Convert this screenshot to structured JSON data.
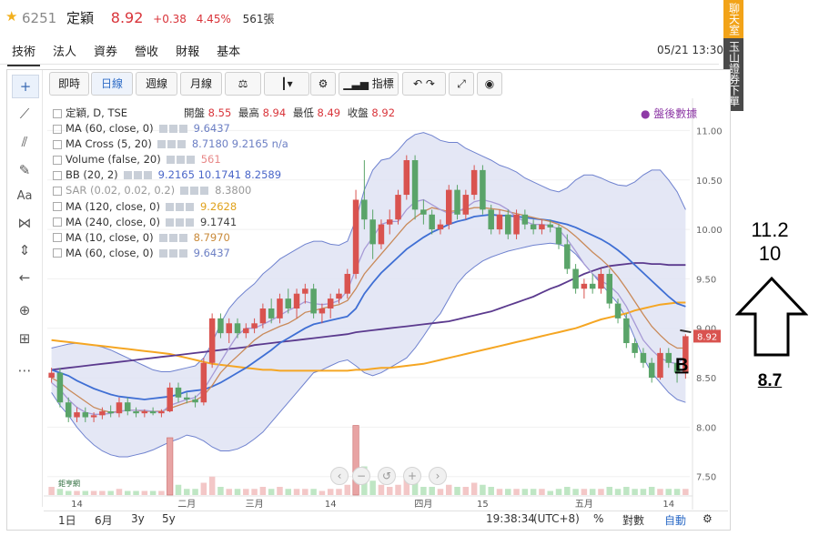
{
  "header": {
    "code": "6251",
    "name": "定穎",
    "price": "8.92",
    "change": "+0.38",
    "change_pct": "4.45%",
    "volume": "561張"
  },
  "tabs": [
    "技術",
    "法人",
    "資券",
    "營收",
    "財報",
    "基本"
  ],
  "timestamp": "05/21 13:30",
  "side_tabs": [
    {
      "label": "聊天室",
      "color": "#f2a318"
    },
    {
      "label": "玉山證券下單",
      "color": "#4a4a4a"
    }
  ],
  "toolbar": {
    "realtime": "即時",
    "daily": "日線",
    "weekly": "週線",
    "monthly": "月線",
    "indicators": "指標"
  },
  "ohlc": {
    "open_label": "開盤",
    "open": "8.55",
    "high_label": "最高",
    "high": "8.94",
    "low_label": "最低",
    "low": "8.49",
    "close_label": "收盤",
    "close": "8.92"
  },
  "legend": [
    {
      "name": "定穎, D, TSE",
      "value": "",
      "color": "#333333"
    },
    {
      "name": "MA (60, close, 0)",
      "value": "9.6437",
      "color": "#6c7fc4"
    },
    {
      "name": "MA Cross (5, 20)",
      "value": "8.7180  9.2165 n/a",
      "color": "#6c7fc4"
    },
    {
      "name": "Volume (false, 20)",
      "value": "561",
      "color": "#e88888"
    },
    {
      "name": "BB (20, 2)",
      "value": "9.2165  10.1741  8.2589",
      "color": "#4a66c8"
    },
    {
      "name": "SAR (0.02, 0.02, 0.2)",
      "value": "8.3800",
      "color": "#999999"
    },
    {
      "name": "MA (120, close, 0)",
      "value": "9.2628",
      "color": "#e0a21c"
    },
    {
      "name": "MA (240, close, 0)",
      "value": "9.1741",
      "color": "#444444"
    },
    {
      "name": "MA (10, close, 0)",
      "value": "8.7970",
      "color": "#c98a3a"
    },
    {
      "name": "MA (60, close, 0)",
      "value": "9.6437",
      "color": "#6c7fc4"
    }
  ],
  "after_hours": "盤後數據",
  "bottom_bar": {
    "ranges": [
      "1日",
      "6月",
      "3y",
      "5y"
    ],
    "clock": "19:38:34",
    "tz": "(UTC+8)",
    "pct": "%",
    "log": "對數",
    "auto": "自動"
  },
  "logo_text": "鉅亨網",
  "annotations": {
    "target_high": "11.2",
    "target_mid": "10",
    "support": "8.7",
    "marker": "B"
  },
  "colors": {
    "up": "#d9534f",
    "down": "#5aa469",
    "bb_fill": "#dfe3f3",
    "ma_blue": "#3f6fd4",
    "ma_purple": "#5b3a8e",
    "ma_orange": "#f5a623",
    "ma_brown": "#c98a5a"
  },
  "chart_data": {
    "type": "candlestick",
    "x_tick_labels": [
      "14",
      "二月",
      "三月",
      "14",
      "四月",
      "15",
      "五月",
      "14"
    ],
    "y_tick_labels": [
      "7.50",
      "8.00",
      "8.50",
      "9.00",
      "9.50",
      "10.00",
      "10.50",
      "11.00"
    ],
    "ylim": [
      7.35,
      11.05
    ],
    "last_price_label": "8.92",
    "candles": [
      [
        8.5,
        8.6,
        8.45,
        8.55
      ],
      [
        8.55,
        8.6,
        8.2,
        8.25
      ],
      [
        8.25,
        8.3,
        8.05,
        8.1
      ],
      [
        8.1,
        8.2,
        8.05,
        8.15
      ],
      [
        8.15,
        8.2,
        8.05,
        8.1
      ],
      [
        8.1,
        8.15,
        8.05,
        8.12
      ],
      [
        8.12,
        8.2,
        8.08,
        8.16
      ],
      [
        8.16,
        8.22,
        8.1,
        8.14
      ],
      [
        8.14,
        8.3,
        8.1,
        8.25
      ],
      [
        8.25,
        8.3,
        8.12,
        8.16
      ],
      [
        8.16,
        8.2,
        8.1,
        8.14
      ],
      [
        8.14,
        8.18,
        8.1,
        8.16
      ],
      [
        8.16,
        8.2,
        8.12,
        8.14
      ],
      [
        8.14,
        8.18,
        8.1,
        8.16
      ],
      [
        8.16,
        8.45,
        8.15,
        8.4
      ],
      [
        8.4,
        8.45,
        8.25,
        8.3
      ],
      [
        8.3,
        8.35,
        8.24,
        8.28
      ],
      [
        8.28,
        8.32,
        8.2,
        8.25
      ],
      [
        8.25,
        8.7,
        8.22,
        8.65
      ],
      [
        8.65,
        9.15,
        8.6,
        9.1
      ],
      [
        9.1,
        9.15,
        8.9,
        8.95
      ],
      [
        8.95,
        9.1,
        8.85,
        9.05
      ],
      [
        9.05,
        9.1,
        8.9,
        8.95
      ],
      [
        8.95,
        9.05,
        8.9,
        9.0
      ],
      [
        9.0,
        9.1,
        8.95,
        9.05
      ],
      [
        9.05,
        9.25,
        9.0,
        9.2
      ],
      [
        9.2,
        9.3,
        9.05,
        9.1
      ],
      [
        9.1,
        9.35,
        9.05,
        9.3
      ],
      [
        9.3,
        9.4,
        9.15,
        9.2
      ],
      [
        9.2,
        9.4,
        9.1,
        9.35
      ],
      [
        9.35,
        9.45,
        9.25,
        9.4
      ],
      [
        9.4,
        9.45,
        9.1,
        9.15
      ],
      [
        9.15,
        9.25,
        9.05,
        9.2
      ],
      [
        9.2,
        9.35,
        9.1,
        9.3
      ],
      [
        9.3,
        9.4,
        9.25,
        9.35
      ],
      [
        9.35,
        9.6,
        9.3,
        9.55
      ],
      [
        9.55,
        10.4,
        9.5,
        10.3
      ],
      [
        10.3,
        10.7,
        10.0,
        10.1
      ],
      [
        10.1,
        10.2,
        9.7,
        9.85
      ],
      [
        9.85,
        10.1,
        9.8,
        10.05
      ],
      [
        10.05,
        10.2,
        9.95,
        10.1
      ],
      [
        10.1,
        10.4,
        10.05,
        10.35
      ],
      [
        10.35,
        10.75,
        10.3,
        10.7
      ],
      [
        10.7,
        10.75,
        10.1,
        10.2
      ],
      [
        10.2,
        10.3,
        10.05,
        10.15
      ],
      [
        10.15,
        10.2,
        9.95,
        10.0
      ],
      [
        10.0,
        10.1,
        9.95,
        10.05
      ],
      [
        10.05,
        10.45,
        10.0,
        10.4
      ],
      [
        10.4,
        10.45,
        10.1,
        10.15
      ],
      [
        10.15,
        10.4,
        10.1,
        10.35
      ],
      [
        10.35,
        10.65,
        10.3,
        10.6
      ],
      [
        10.6,
        10.65,
        10.15,
        10.2
      ],
      [
        10.2,
        10.25,
        9.95,
        10.0
      ],
      [
        10.0,
        10.2,
        9.95,
        10.15
      ],
      [
        10.15,
        10.2,
        9.9,
        9.95
      ],
      [
        9.95,
        10.2,
        9.9,
        10.15
      ],
      [
        10.15,
        10.2,
        10.0,
        10.05
      ],
      [
        10.05,
        10.1,
        9.95,
        10.0
      ],
      [
        10.0,
        10.1,
        9.95,
        10.05
      ],
      [
        10.05,
        10.1,
        9.97,
        10.02
      ],
      [
        10.02,
        10.05,
        9.8,
        9.85
      ],
      [
        9.85,
        9.95,
        9.55,
        9.6
      ],
      [
        9.6,
        9.65,
        9.35,
        9.4
      ],
      [
        9.4,
        9.5,
        9.3,
        9.45
      ],
      [
        9.45,
        9.55,
        9.35,
        9.4
      ],
      [
        9.4,
        9.6,
        9.35,
        9.55
      ],
      [
        9.55,
        9.6,
        9.2,
        9.25
      ],
      [
        9.25,
        9.3,
        9.05,
        9.1
      ],
      [
        9.1,
        9.15,
        8.8,
        8.85
      ],
      [
        8.85,
        8.9,
        8.7,
        8.75
      ],
      [
        8.75,
        8.8,
        8.6,
        8.65
      ],
      [
        8.65,
        8.7,
        8.45,
        8.5
      ],
      [
        8.5,
        8.8,
        8.48,
        8.75
      ],
      [
        8.75,
        8.8,
        8.6,
        8.65
      ],
      [
        8.65,
        8.7,
        8.45,
        8.55
      ],
      [
        8.55,
        8.94,
        8.49,
        8.92
      ]
    ],
    "volume": [
      4,
      3,
      2,
      2,
      2,
      2,
      2,
      2,
      3,
      2,
      2,
      2,
      2,
      2,
      28,
      5,
      3,
      3,
      6,
      9,
      4,
      3,
      3,
      3,
      3,
      4,
      3,
      4,
      3,
      3,
      3,
      3,
      2,
      3,
      3,
      5,
      34,
      14,
      7,
      5,
      4,
      5,
      8,
      6,
      4,
      4,
      3,
      5,
      4,
      4,
      6,
      5,
      4,
      3,
      3,
      3,
      3,
      3,
      3,
      2,
      3,
      4,
      3,
      3,
      3,
      3,
      4,
      3,
      4,
      3,
      3,
      4,
      3,
      3,
      3,
      3
    ],
    "series": [
      {
        "name": "BB (20, 2)",
        "upper": [
          8.8,
          8.82,
          8.84,
          8.85,
          8.84,
          8.83,
          8.81,
          8.78,
          8.74,
          8.7,
          8.66,
          8.62,
          8.58,
          8.56,
          8.56,
          8.58,
          8.6,
          8.62,
          8.7,
          8.85,
          9.05,
          9.2,
          9.3,
          9.38,
          9.45,
          9.55,
          9.62,
          9.7,
          9.75,
          9.8,
          9.85,
          9.88,
          9.88,
          9.85,
          9.84,
          9.88,
          10.1,
          10.4,
          10.6,
          10.7,
          10.72,
          10.8,
          10.9,
          10.96,
          10.98,
          10.95,
          10.9,
          10.88,
          10.88,
          10.82,
          10.78,
          10.74,
          10.7,
          10.65,
          10.62,
          10.58,
          10.52,
          10.48,
          10.44,
          10.4,
          10.38,
          10.42,
          10.5,
          10.55,
          10.55,
          10.52,
          10.48,
          10.45,
          10.44,
          10.48,
          10.55,
          10.6,
          10.6,
          10.5,
          10.38,
          10.2
        ]
      },
      {
        "name": "BB (20, 2)",
        "lower": [
          8.35,
          8.22,
          8.12,
          8.0,
          7.9,
          7.82,
          7.76,
          7.72,
          7.7,
          7.7,
          7.72,
          7.74,
          7.77,
          7.81,
          7.85,
          7.88,
          7.92,
          7.9,
          7.86,
          7.8,
          7.76,
          7.76,
          7.78,
          7.82,
          7.88,
          7.95,
          8.05,
          8.15,
          8.25,
          8.35,
          8.45,
          8.55,
          8.58,
          8.62,
          8.66,
          8.68,
          8.62,
          8.55,
          8.52,
          8.55,
          8.6,
          8.65,
          8.7,
          8.8,
          8.92,
          9.05,
          9.15,
          9.3,
          9.45,
          9.55,
          9.62,
          9.68,
          9.72,
          9.75,
          9.78,
          9.8,
          9.82,
          9.84,
          9.85,
          9.86,
          9.85,
          9.82,
          9.75,
          9.65,
          9.55,
          9.45,
          9.35,
          9.25,
          9.1,
          8.9,
          8.7,
          8.55,
          8.45,
          8.35,
          8.28,
          8.25
        ]
      },
      {
        "name": "MA (20, close)",
        "values": [
          8.58,
          8.55,
          8.52,
          8.47,
          8.43,
          8.39,
          8.36,
          8.33,
          8.31,
          8.3,
          8.29,
          8.28,
          8.29,
          8.3,
          8.31,
          8.33,
          8.36,
          8.37,
          8.38,
          8.41,
          8.45,
          8.5,
          8.55,
          8.6,
          8.66,
          8.72,
          8.78,
          8.85,
          8.9,
          8.95,
          9.0,
          9.04,
          9.06,
          9.08,
          9.1,
          9.12,
          9.2,
          9.35,
          9.46,
          9.56,
          9.64,
          9.72,
          9.8,
          9.86,
          9.92,
          9.97,
          10.01,
          10.05,
          10.08,
          10.1,
          10.13,
          10.14,
          10.15,
          10.14,
          10.14,
          10.13,
          10.12,
          10.11,
          10.1,
          10.09,
          10.07,
          10.05,
          10.02,
          9.98,
          9.94,
          9.9,
          9.85,
          9.79,
          9.72,
          9.64,
          9.56,
          9.48,
          9.4,
          9.32,
          9.25,
          9.22
        ]
      },
      {
        "name": "MA (10, close, 0)",
        "values": [
          8.5,
          8.45,
          8.38,
          8.32,
          8.26,
          8.2,
          8.17,
          8.15,
          8.16,
          8.17,
          8.17,
          8.16,
          8.16,
          8.16,
          8.19,
          8.22,
          8.25,
          8.27,
          8.32,
          8.42,
          8.55,
          8.64,
          8.72,
          8.8,
          8.88,
          8.94,
          8.98,
          9.02,
          9.05,
          9.1,
          9.16,
          9.18,
          9.2,
          9.22,
          9.24,
          9.28,
          9.4,
          9.55,
          9.65,
          9.75,
          9.85,
          9.95,
          10.05,
          10.12,
          10.18,
          10.22,
          10.2,
          10.18,
          10.19,
          10.2,
          10.22,
          10.22,
          10.21,
          10.2,
          10.18,
          10.16,
          10.14,
          10.12,
          10.1,
          10.08,
          10.05,
          10.0,
          9.93,
          9.85,
          9.77,
          9.7,
          9.62,
          9.52,
          9.4,
          9.27,
          9.14,
          9.02,
          8.93,
          8.85,
          8.8,
          8.8
        ]
      },
      {
        "name": "MA (5, close)",
        "values": [
          8.45,
          8.38,
          8.28,
          8.2,
          8.15,
          8.13,
          8.13,
          8.14,
          8.16,
          8.17,
          8.17,
          8.17,
          8.16,
          8.15,
          8.22,
          8.25,
          8.28,
          8.3,
          8.38,
          8.52,
          8.66,
          8.8,
          8.93,
          9.0,
          9.0,
          9.04,
          9.08,
          9.13,
          9.18,
          9.22,
          9.27,
          9.25,
          9.24,
          9.25,
          9.28,
          9.38,
          9.6,
          9.8,
          9.92,
          10.05,
          10.08,
          10.08,
          10.2,
          10.28,
          10.3,
          10.25,
          10.2,
          10.16,
          10.18,
          10.22,
          10.28,
          10.3,
          10.28,
          10.25,
          10.2,
          10.12,
          10.08,
          10.05,
          10.05,
          10.04,
          10.0,
          9.9,
          9.78,
          9.65,
          9.55,
          9.48,
          9.43,
          9.35,
          9.22,
          9.05,
          8.88,
          8.78,
          8.7,
          8.66,
          8.64,
          8.72
        ]
      },
      {
        "name": "MA (240, close, 0)",
        "values": [
          8.88,
          8.87,
          8.86,
          8.85,
          8.84,
          8.83,
          8.82,
          8.81,
          8.8,
          8.79,
          8.78,
          8.77,
          8.76,
          8.75,
          8.74,
          8.72,
          8.7,
          8.68,
          8.66,
          8.64,
          8.63,
          8.62,
          8.61,
          8.6,
          8.59,
          8.58,
          8.58,
          8.57,
          8.57,
          8.57,
          8.57,
          8.57,
          8.57,
          8.57,
          8.57,
          8.57,
          8.58,
          8.58,
          8.59,
          8.6,
          8.6,
          8.61,
          8.62,
          8.63,
          8.64,
          8.66,
          8.68,
          8.7,
          8.72,
          8.74,
          8.76,
          8.78,
          8.8,
          8.82,
          8.84,
          8.86,
          8.88,
          8.9,
          8.92,
          8.94,
          8.96,
          8.98,
          9.0,
          9.03,
          9.06,
          9.09,
          9.11,
          9.13,
          9.15,
          9.18,
          9.2,
          9.22,
          9.24,
          9.25,
          9.26,
          9.26
        ]
      },
      {
        "name": "MA (120, close, 0)",
        "values": [
          8.58,
          8.59,
          8.6,
          8.61,
          8.62,
          8.63,
          8.64,
          8.65,
          8.66,
          8.67,
          8.68,
          8.69,
          8.7,
          8.71,
          8.72,
          8.73,
          8.74,
          8.75,
          8.76,
          8.77,
          8.78,
          8.79,
          8.8,
          8.81,
          8.83,
          8.84,
          8.85,
          8.86,
          8.87,
          8.88,
          8.89,
          8.9,
          8.91,
          8.92,
          8.93,
          8.94,
          8.96,
          8.97,
          8.98,
          8.99,
          9.0,
          9.01,
          9.02,
          9.03,
          9.04,
          9.05,
          9.06,
          9.07,
          9.09,
          9.11,
          9.13,
          9.15,
          9.17,
          9.2,
          9.23,
          9.26,
          9.29,
          9.32,
          9.36,
          9.4,
          9.43,
          9.47,
          9.51,
          9.55,
          9.58,
          9.61,
          9.63,
          9.64,
          9.65,
          9.66,
          9.66,
          9.65,
          9.65,
          9.64,
          9.64,
          9.64
        ]
      }
    ]
  }
}
